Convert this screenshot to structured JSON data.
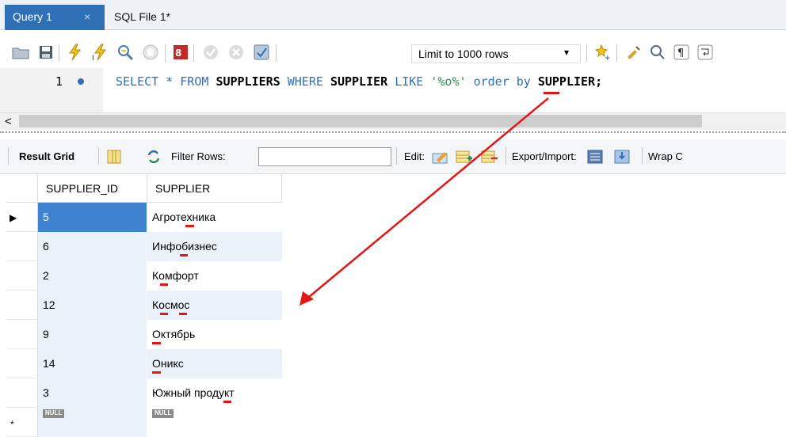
{
  "tabs": [
    {
      "label": "Query 1",
      "close": "×",
      "active": true
    },
    {
      "label": "SQL File 1*",
      "active": false
    }
  ],
  "toolbar": {
    "limit_value": "Limit to 1000 rows",
    "limit_caret": "▾",
    "icons": [
      "open-folder-icon",
      "save-icon",
      "execute-icon",
      "execute-current-icon",
      "explain-icon",
      "stop-icon",
      "toggle-error-icon",
      "commit-icon",
      "rollback-icon",
      "autocommit-icon",
      "beautify-icon",
      "broom-icon",
      "find-icon",
      "invisible-chars-icon",
      "wrap-icon"
    ]
  },
  "editor": {
    "line_number": "1",
    "sql_tokens": [
      {
        "t": "SELECT",
        "c": "kw"
      },
      {
        "t": " * ",
        "c": "kw"
      },
      {
        "t": "FROM",
        "c": "kw"
      },
      {
        "t": " ",
        "c": ""
      },
      {
        "t": "SUPPLIERS",
        "c": "ident"
      },
      {
        "t": " ",
        "c": ""
      },
      {
        "t": "WHERE",
        "c": "kw"
      },
      {
        "t": " ",
        "c": ""
      },
      {
        "t": "SUPPLIER",
        "c": "ident"
      },
      {
        "t": " ",
        "c": ""
      },
      {
        "t": "LIKE",
        "c": "kw"
      },
      {
        "t": " ",
        "c": ""
      },
      {
        "t": "'%o%'",
        "c": "str"
      },
      {
        "t": " ",
        "c": ""
      },
      {
        "t": "order by",
        "c": "kw"
      },
      {
        "t": " ",
        "c": ""
      },
      {
        "t": "SUPPLIER;",
        "c": "ident"
      }
    ]
  },
  "scrollbar": {
    "left_arrow": "<"
  },
  "result_toolbar": {
    "result_grid": "Result Grid",
    "filter_rows": "Filter Rows:",
    "filter_value": "",
    "edit": "Edit:",
    "export_import": "Export/Import:",
    "wrap": "Wrap C"
  },
  "grid": {
    "columns": [
      "SUPPLIER_ID",
      "SUPPLIER"
    ],
    "rows": [
      {
        "id": "5",
        "name": "Агротехника"
      },
      {
        "id": "6",
        "name": "Инфобизнес"
      },
      {
        "id": "2",
        "name": "Комфорт"
      },
      {
        "id": "12",
        "name": "Космос"
      },
      {
        "id": "9",
        "name": "Октябрь"
      },
      {
        "id": "14",
        "name": "Оникс"
      },
      {
        "id": "3",
        "name": "Южный продукт"
      }
    ],
    "new_row": {
      "id": "NULL",
      "name": "NULL"
    },
    "current_row_marker": "▶",
    "new_row_marker": "*"
  },
  "colors": {
    "accent": "#2f6fb6",
    "selected": "#3e82d0",
    "stripe": "#eaf1f9",
    "highlight": "#e51616"
  }
}
